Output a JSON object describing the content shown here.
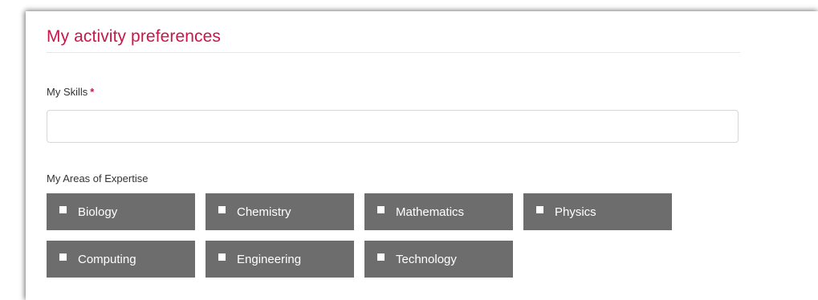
{
  "section": {
    "title": "My activity preferences"
  },
  "skills": {
    "label": "My Skills",
    "required_marker": "*",
    "value": ""
  },
  "expertise": {
    "label": "My Areas of Expertise",
    "options": [
      {
        "label": "Biology",
        "checked": false
      },
      {
        "label": "Chemistry",
        "checked": false
      },
      {
        "label": "Mathematics",
        "checked": false
      },
      {
        "label": "Physics",
        "checked": false
      },
      {
        "label": "Computing",
        "checked": false
      },
      {
        "label": "Engineering",
        "checked": false
      },
      {
        "label": "Technology",
        "checked": false
      }
    ]
  },
  "colors": {
    "accent": "#c8174a",
    "chip_background": "#6d6d6d",
    "chip_text": "#ffffff"
  }
}
